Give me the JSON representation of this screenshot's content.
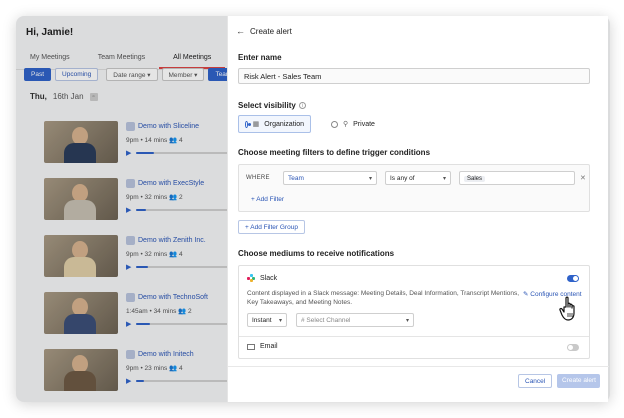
{
  "background": {
    "greeting": "Hi, Jamie!",
    "tabs": [
      "My Meetings",
      "Team Meetings",
      "All Meetings"
    ],
    "filters": {
      "past": "Past",
      "upcoming": "Upcoming",
      "date_range": "Date range ▾",
      "member": "Member ▾",
      "team": "Team"
    },
    "date": {
      "day": "Thu,",
      "label": "16th Jan"
    },
    "meetings": [
      {
        "title": "Demo with Sliceline",
        "meta": "9pm  •  14 mins   👥 4",
        "progress": 0.18
      },
      {
        "title": "Demo with ExecStyle",
        "meta": "9pm  •  32 mins   👥 2",
        "progress": 0.1
      },
      {
        "title": "Demo with Zenith Inc.",
        "meta": "9pm  •  32 mins   👥 4",
        "progress": 0.12
      },
      {
        "title": "Demo with TechnoSoft",
        "meta": "1:45am  •  34 mins   👥 2",
        "progress": 0.14
      },
      {
        "title": "Demo with Initech",
        "meta": "9pm  •  23 mins   👥 4",
        "progress": 0.08
      }
    ]
  },
  "panel": {
    "header": "Create alert",
    "enter_name_label": "Enter name",
    "name_value": "Risk Alert - Sales Team",
    "visibility_label": "Select visibility",
    "visibility_options": {
      "organization": "Organization",
      "private": "Private"
    },
    "filters_label": "Choose meeting filters to define trigger conditions",
    "filter_row": {
      "where": "WHERE",
      "field": "Team",
      "operator": "Is any of",
      "value": "Sales"
    },
    "add_filter": "+  Add Filter",
    "add_filter_group": "+  Add Filter Group",
    "mediums_label": "Choose mediums to receive notifications",
    "slack": {
      "name": "Slack",
      "enabled": true,
      "description": "Content displayed in a Slack message: Meeting Details, Deal Information, Transcript Mentions, Key Takeaways, and Meeting Notes.",
      "configure": "Configure content",
      "frequency": "Instant",
      "channel_placeholder": "# Select Channel"
    },
    "email": {
      "name": "Email",
      "enabled": false
    },
    "cancel": "Cancel",
    "create": "Create alert"
  },
  "colors": {
    "accent": "#2f62c9",
    "link": "#2a55b5",
    "disabled": "#b5c6ea"
  }
}
